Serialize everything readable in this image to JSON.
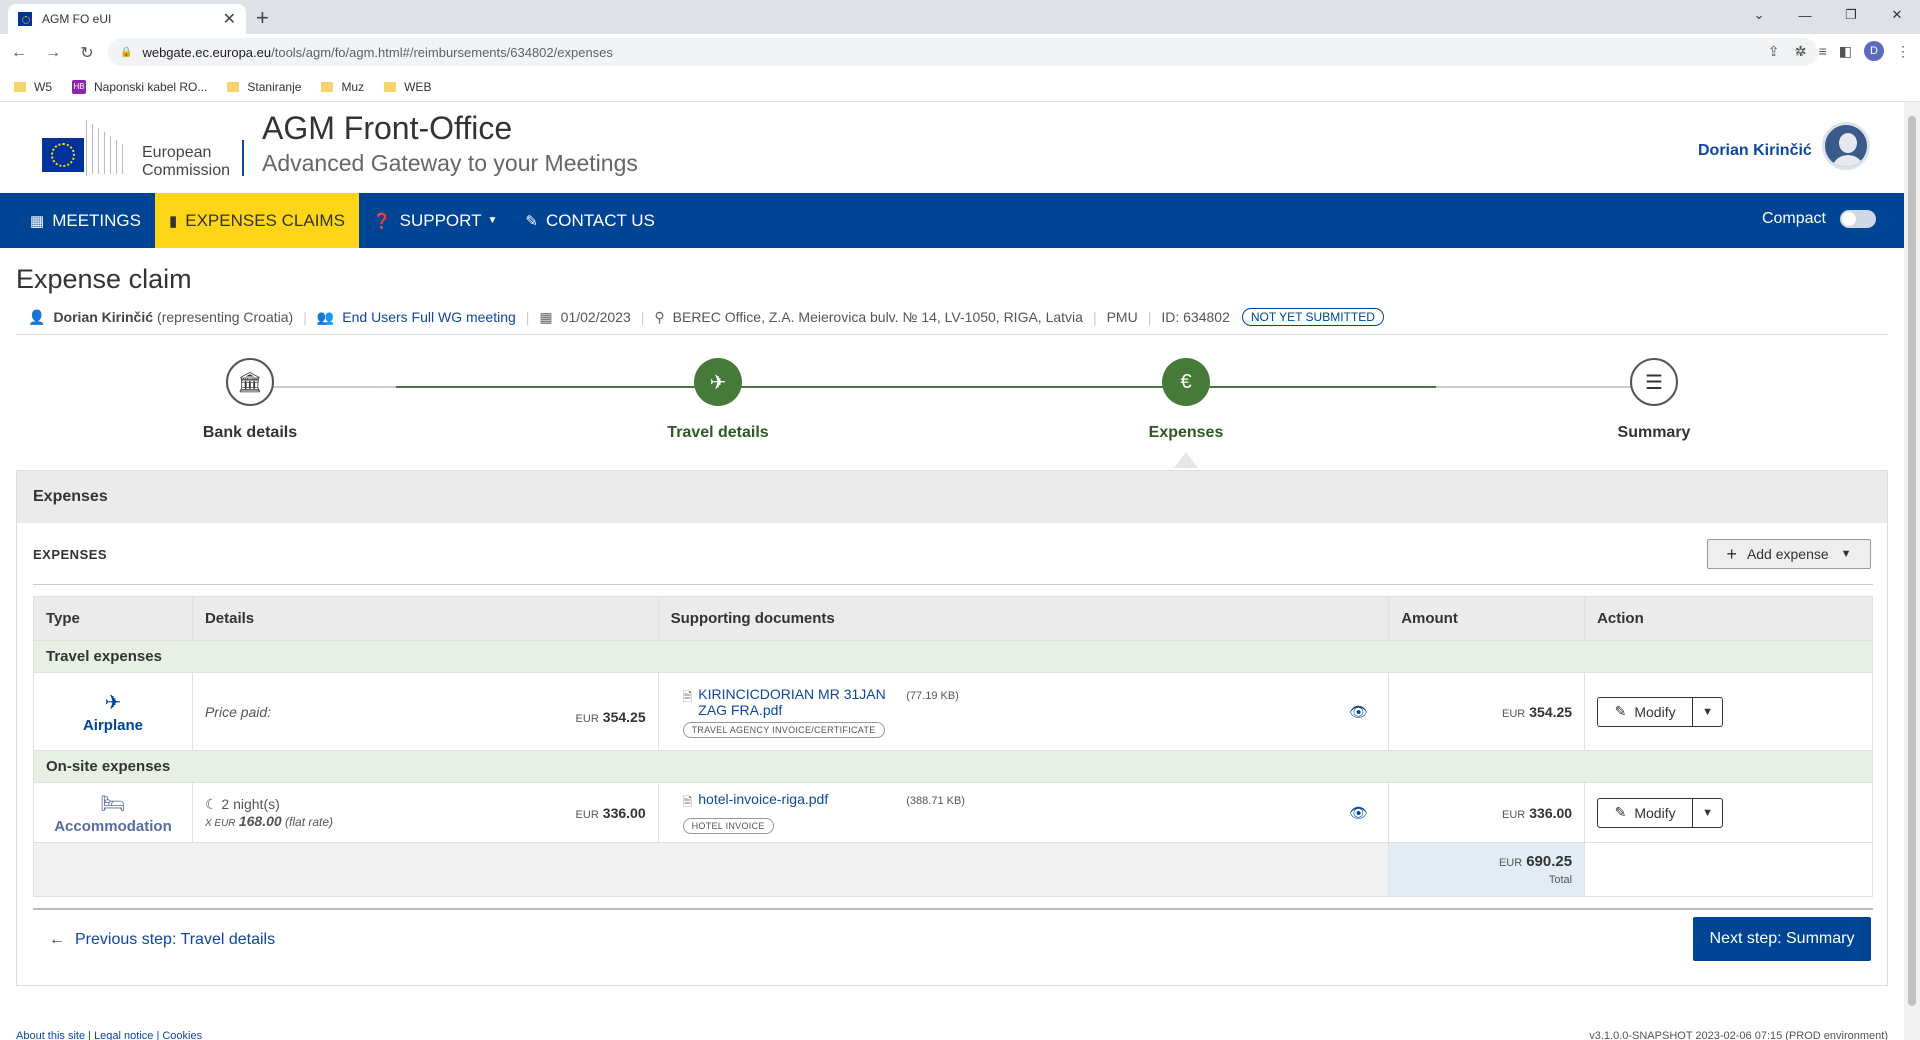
{
  "browser": {
    "tab_title": "AGM FO eUI",
    "url_host": "webgate.ec.europa.eu",
    "url_path": "/tools/agm/fo/agm.html#/reimbursements/634802/expenses",
    "profile_initial": "D",
    "bookmarks": [
      "W5",
      "Naponski kabel RO...",
      "Staniranje",
      "Muz",
      "WEB"
    ],
    "bookmark_hb_badge": "HB"
  },
  "header": {
    "ec_line1": "European",
    "ec_line2": "Commission",
    "title": "AGM Front-Office",
    "subtitle": "Advanced Gateway to your Meetings",
    "user_name": "Dorian Kirinčić"
  },
  "nav": {
    "items": [
      {
        "label": "MEETINGS",
        "icon": "calendar-icon"
      },
      {
        "label": "EXPENSES CLAIMS",
        "icon": "receipt-icon"
      },
      {
        "label": "SUPPORT",
        "icon": "question-icon"
      },
      {
        "label": "CONTACT US",
        "icon": "edit-icon"
      }
    ],
    "compact_label": "Compact",
    "active_color": "#ffd617",
    "bar_color": "#004494"
  },
  "claim": {
    "title": "Expense claim",
    "participant": "Dorian Kirinčić",
    "representing": "(representing Croatia)",
    "meeting": "End Users Full WG meeting",
    "date": "01/02/2023",
    "location": "BEREC Office, Z.A. Meierovica bulv. № 14, LV-1050, RIGA, Latvia",
    "unit": "PMU",
    "id_text": "ID: 634802",
    "status": "NOT YET SUBMITTED"
  },
  "steps": [
    {
      "label": "Bank details",
      "icon": "bank-icon",
      "state": "todo"
    },
    {
      "label": "Travel details",
      "icon": "plane-icon",
      "state": "done"
    },
    {
      "label": "Expenses",
      "icon": "euro-icon",
      "state": "done"
    },
    {
      "label": "Summary",
      "icon": "list-icon",
      "state": "todo"
    }
  ],
  "expenses": {
    "panel_title": "Expenses",
    "section_title": "EXPENSES",
    "add_label": "Add expense",
    "columns": [
      "Type",
      "Details",
      "Supporting documents",
      "Amount",
      "Action"
    ],
    "groups": [
      {
        "name": "Travel expenses",
        "type": "Airplane",
        "details_label": "Price paid:",
        "details_currency": "EUR",
        "details_amount": "354.25",
        "doc_name": "KIRINCICDORIAN MR 31JAN ZAG FRA.pdf",
        "doc_size": "(77.19 KB)",
        "doc_tag": "TRAVEL AGENCY INVOICE/CERTIFICATE",
        "amount_currency": "EUR",
        "amount": "354.25",
        "action": "Modify"
      },
      {
        "name": "On-site expenses",
        "type": "Accommodation",
        "nights": "2 night(s)",
        "rate_prefix": "X EUR",
        "rate": "168.00",
        "rate_suffix": "(flat rate)",
        "details_currency": "EUR",
        "details_amount": "336.00",
        "doc_name": "hotel-invoice-riga.pdf",
        "doc_size": "(388.71 KB)",
        "doc_tag": "HOTEL INVOICE",
        "amount_currency": "EUR",
        "amount": "336.00",
        "action": "Modify"
      }
    ],
    "total_currency": "EUR",
    "total": "690.25",
    "total_label": "Total"
  },
  "footer_nav": {
    "prev_label": "Previous step: Travel details",
    "next_label": "Next step: Summary"
  },
  "footer": {
    "links": "About this site | Legal notice | Cookies",
    "version": "v3.1.0.0-SNAPSHOT 2023-02-06 07:15 (PROD environment)"
  }
}
